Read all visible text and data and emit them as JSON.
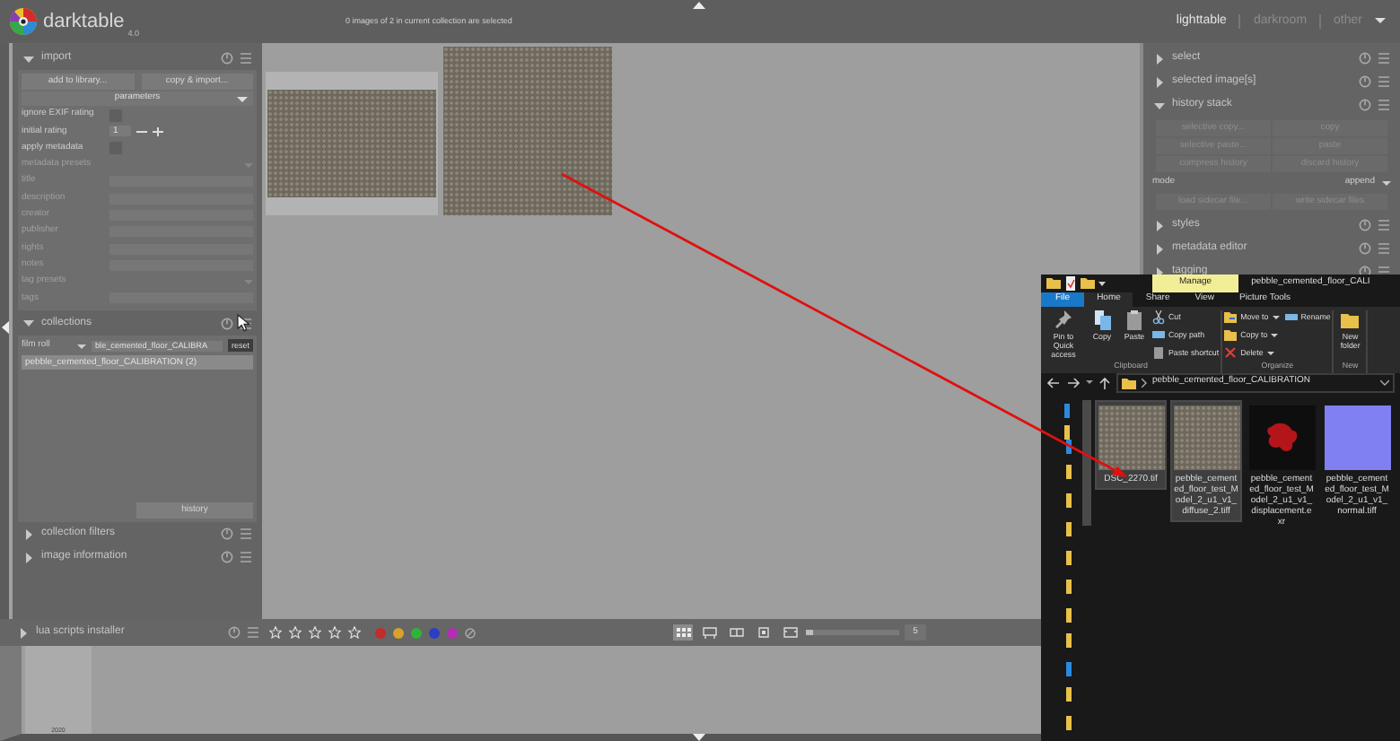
{
  "app": {
    "name": "darktable",
    "version": "4.0"
  },
  "top_bar": {
    "status": "0 images of 2 in current collection are selected",
    "views": [
      {
        "label": "lighttable",
        "selected": true
      },
      {
        "label": "darkroom",
        "selected": false
      },
      {
        "label": "other",
        "selected": false
      }
    ]
  },
  "left_panel": {
    "import": {
      "title": "import",
      "expanded": true,
      "buttons": [
        "add to library...",
        "copy & import..."
      ],
      "parameters": {
        "title": "parameters",
        "rows": [
          {
            "kind": "checkbox",
            "label": "ignore EXIF rating",
            "checked": false,
            "disabled": false
          },
          {
            "kind": "stepper",
            "label": "initial rating",
            "value": "1",
            "disabled": false
          },
          {
            "kind": "checkbox",
            "label": "apply metadata",
            "checked": false,
            "disabled": false
          },
          {
            "kind": "dropdown",
            "label": "metadata presets",
            "disabled": true
          },
          {
            "kind": "text",
            "label": "title",
            "disabled": true
          },
          {
            "kind": "text",
            "label": "description",
            "disabled": true
          },
          {
            "kind": "text",
            "label": "creator",
            "disabled": true
          },
          {
            "kind": "text",
            "label": "publisher",
            "disabled": true
          },
          {
            "kind": "text",
            "label": "rights",
            "disabled": true
          },
          {
            "kind": "text",
            "label": "notes",
            "disabled": true
          },
          {
            "kind": "dropdown",
            "label": "tag presets",
            "disabled": true
          },
          {
            "kind": "text",
            "label": "tags",
            "disabled": true
          }
        ]
      }
    },
    "collections": {
      "title": "collections",
      "expanded": true,
      "property": "film roll",
      "query": "ble_cemented_floor_CALIBRA",
      "tooltip": "reset",
      "items": [
        {
          "label": "pebble_cemented_floor_CALIBRATION (2)",
          "selected": true
        }
      ],
      "history_button": "history"
    },
    "modules": [
      {
        "title": "collection filters",
        "expanded": false
      },
      {
        "title": "image information",
        "expanded": false
      }
    ],
    "bottom_module": {
      "title": "lua scripts installer",
      "expanded": false
    }
  },
  "center": {
    "thumbnails": [
      {
        "hovered": true
      },
      {
        "hovered": false
      }
    ]
  },
  "right_panel": {
    "modules": [
      {
        "kind": "plain",
        "title": "select",
        "expanded": false
      },
      {
        "kind": "plain",
        "title": "selected image[s]",
        "expanded": false
      },
      {
        "kind": "history",
        "title": "history stack",
        "expanded": true,
        "buttons": [
          "selective copy...",
          "copy",
          "selective paste...",
          "paste",
          "compress history",
          "discard history"
        ],
        "mode_label": "mode",
        "mode_value": "append",
        "sidecar_buttons": [
          "load sidecar file...",
          "write sidecar files"
        ]
      },
      {
        "kind": "plain",
        "title": "styles",
        "expanded": false
      },
      {
        "kind": "plain",
        "title": "metadata editor",
        "expanded": false
      },
      {
        "kind": "plain",
        "title": "tagging",
        "expanded": false
      }
    ]
  },
  "bottom_bar": {
    "stars": 0,
    "color_labels": [
      {
        "color": "#c42b2b"
      },
      {
        "color": "#d9a02a"
      },
      {
        "color": "#2fb33a"
      },
      {
        "color": "#2b3fc4"
      },
      {
        "color": "#b52cb5"
      }
    ],
    "layouts": [
      {
        "kind": "filemanager",
        "selected": true
      },
      {
        "kind": "zoomable",
        "selected": false
      },
      {
        "kind": "culling",
        "selected": false
      },
      {
        "kind": "preview",
        "selected": false
      },
      {
        "kind": "fullscreen",
        "selected": false
      }
    ],
    "zoom": {
      "level": 0.08,
      "value": "5"
    }
  },
  "filmstrip": {
    "thumbnails": [
      {
        "caption": "2020"
      }
    ]
  },
  "explorer": {
    "title": "pebble_cemented_floor_CALI",
    "context_tab": "Manage",
    "tabs": [
      {
        "label": "File",
        "kind": "file",
        "selected": false
      },
      {
        "label": "Home",
        "kind": "tab",
        "selected": true
      },
      {
        "label": "Share",
        "kind": "tab",
        "selected": false
      },
      {
        "label": "View",
        "kind": "tab",
        "selected": false
      },
      {
        "label": "Picture Tools",
        "kind": "tab",
        "selected": false
      }
    ],
    "ribbon": [
      {
        "label": "Clipboard",
        "large": [
          "Pin to Quick access",
          "Copy",
          "Paste"
        ],
        "small": [
          {
            "label": "Cut",
            "menu": false
          },
          {
            "label": "Copy path",
            "menu": false
          },
          {
            "label": "Paste shortcut",
            "menu": false
          }
        ]
      },
      {
        "label": "Organize",
        "small": [
          {
            "label": "Move to",
            "menu": true
          },
          {
            "label": "Copy to",
            "menu": true
          },
          {
            "label": "Delete",
            "menu": true
          },
          {
            "label": "Rename",
            "menu": false
          }
        ]
      },
      {
        "label": "New",
        "large": [
          "New folder"
        ]
      }
    ],
    "address": "pebble_cemented_floor_CALIBRATION",
    "files": [
      {
        "name": "DSC_2270.tif",
        "kind": "photo",
        "selected": true
      },
      {
        "name": "pebble_cemented_floor_test_Model_2_u1_v1_diffuse_2.tiff",
        "kind": "photo",
        "selected": true
      },
      {
        "name": "pebble_cemented_floor_test_Model_2_u1_v1_displacement.exr",
        "kind": "exr",
        "selected": false
      },
      {
        "name": "pebble_cemented_floor_test_Model_2_u1_v1_normal.tiff",
        "kind": "normal",
        "selected": false
      }
    ]
  }
}
